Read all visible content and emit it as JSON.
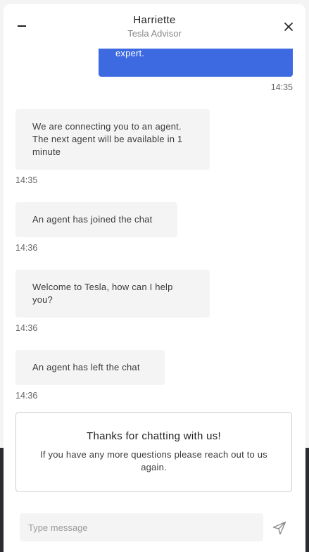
{
  "header": {
    "agent_name": "Harriette",
    "agent_role": "Tesla Advisor"
  },
  "messages": [
    {
      "sender": "user",
      "text": "Please connect me with a Tesla expert.",
      "time": "14:35"
    },
    {
      "sender": "system",
      "text": "We are connecting you to an agent. The next agent will be available in 1 minute",
      "time": "14:35"
    },
    {
      "sender": "system",
      "text": "An agent has joined the chat",
      "time": "14:36"
    },
    {
      "sender": "agent",
      "text": "Welcome to Tesla, how can I help you?",
      "time": "14:36"
    },
    {
      "sender": "system",
      "text": "An agent has left the chat",
      "time": "14:36"
    }
  ],
  "end_card": {
    "title": "Thanks for chatting with us!",
    "text": "If you have any more questions please reach out to us again."
  },
  "composer": {
    "placeholder": "Type message",
    "value": ""
  },
  "icons": {
    "minimize": "minimize-icon",
    "close": "close-icon",
    "send": "send-icon"
  },
  "colors": {
    "user_bubble": "#3e6ae1",
    "agent_bubble": "#f4f4f4"
  }
}
